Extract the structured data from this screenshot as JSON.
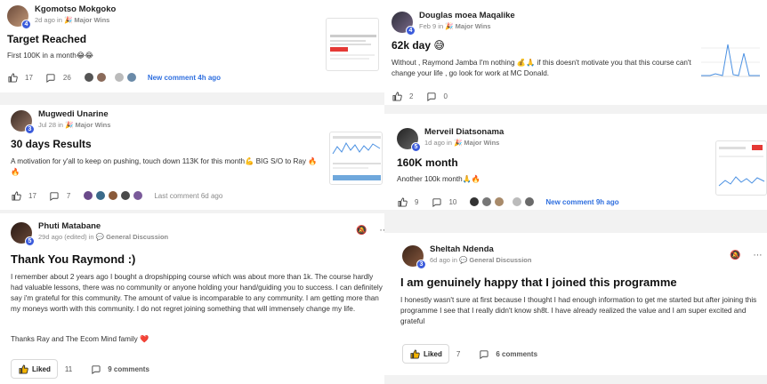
{
  "colors": {
    "accent": "#2f6fdf",
    "level_badge": "#3b5bdb",
    "heart": "#e53935"
  },
  "posts": [
    {
      "author": "Kgomotso Mokgoko",
      "level": "4",
      "time": "2d ago",
      "in": "in",
      "category": "Major Wins",
      "title": "Target Reached",
      "body": "First 100K in a month😂😂",
      "likes": "17",
      "comments": "26",
      "activity": "New comment 4h ago"
    },
    {
      "author": "Douglas moea Maqalike",
      "level": "4",
      "time": "Feb 9",
      "in": "in",
      "category": "Major Wins",
      "title": "62k day 😅",
      "body": "Without , Raymond Jamba I'm nothing 💰🙏 if this doesn't motivate you that this course can't change your life , go look for work at MC Donald.",
      "likes": "2",
      "comments": "0"
    },
    {
      "author": "Mugwedi Unarine",
      "level": "3",
      "time": "Jul 28",
      "in": "in",
      "category": "Major Wins",
      "title": "30 days Results",
      "body": "A motivation for y'all to keep on pushing, touch down 113K for this month💪 BIG S/O to Ray 🔥🔥",
      "likes": "17",
      "comments": "7",
      "activity": "Last comment 6d ago"
    },
    {
      "author": "Merveil Diatsonama",
      "level": "5",
      "time": "1d ago",
      "in": "in",
      "category": "Major Wins",
      "title": "160K month",
      "body": "Another 100k month🙏🔥",
      "likes": "9",
      "comments": "10",
      "activity": "New comment 9h ago"
    },
    {
      "author": "Phuti Matabane",
      "level": "5",
      "time": "29d ago (edited)",
      "in": "in",
      "category": "General Discussion",
      "title": "Thank You Raymond :)",
      "body": "I remember about 2 years ago I bought a dropshipping course which was about more than 1k. The course hardly had valuable lessons, there was no community or anyone holding your hand/guiding you to success. I can definitely say i'm grateful for this community. The amount of value is incomparable to any community. I am getting more than my moneys worth with this community. I do not regret joining something that will immensely change my life.",
      "body2": "Thanks Ray and The Ecom Mind family ❤️",
      "liked_label": "Liked",
      "likes": "11",
      "comments": "9 comments"
    },
    {
      "author": "Sheltah Ndenda",
      "level": "3",
      "time": "6d ago",
      "in": "in",
      "category": "General Discussion",
      "title": "I am genuinely happy that I joined this programme",
      "body": "I honestly wasn't sure at first because I thought I had enough information to get me started but after joining this programme I see that I really didn't know sh8t. I have already realized the value and I am super excited and grateful",
      "liked_label": "Liked",
      "likes": "7",
      "comments": "6 comments"
    }
  ]
}
